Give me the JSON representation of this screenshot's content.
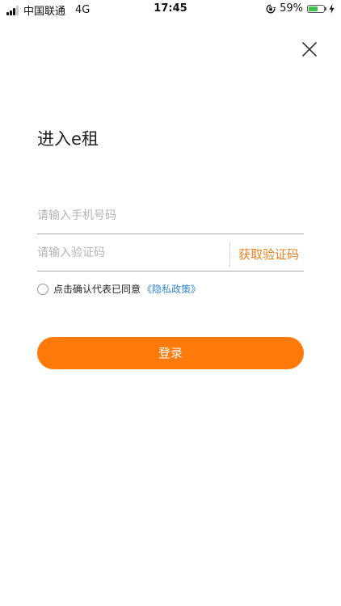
{
  "status_bar": {
    "carrier": "中国联通",
    "network": "4G",
    "time": "17:45",
    "battery_percent_label": "59%",
    "battery_level": 0.59,
    "battery_color": "#3fc34a"
  },
  "header": {
    "close_icon": "close-icon"
  },
  "title": "进入e租",
  "form": {
    "phone_placeholder": "请输入手机号码",
    "phone_value": "",
    "code_placeholder": "请输入验证码",
    "code_value": "",
    "get_code_label": "获取验证码"
  },
  "agreement": {
    "checked": false,
    "text": "点击确认代表已同意",
    "link_label": "《隐私政策》"
  },
  "login_label": "登录",
  "colors": {
    "accent": "#ff7a0a",
    "get_code": "#e8821f",
    "link": "#2f86d6"
  }
}
